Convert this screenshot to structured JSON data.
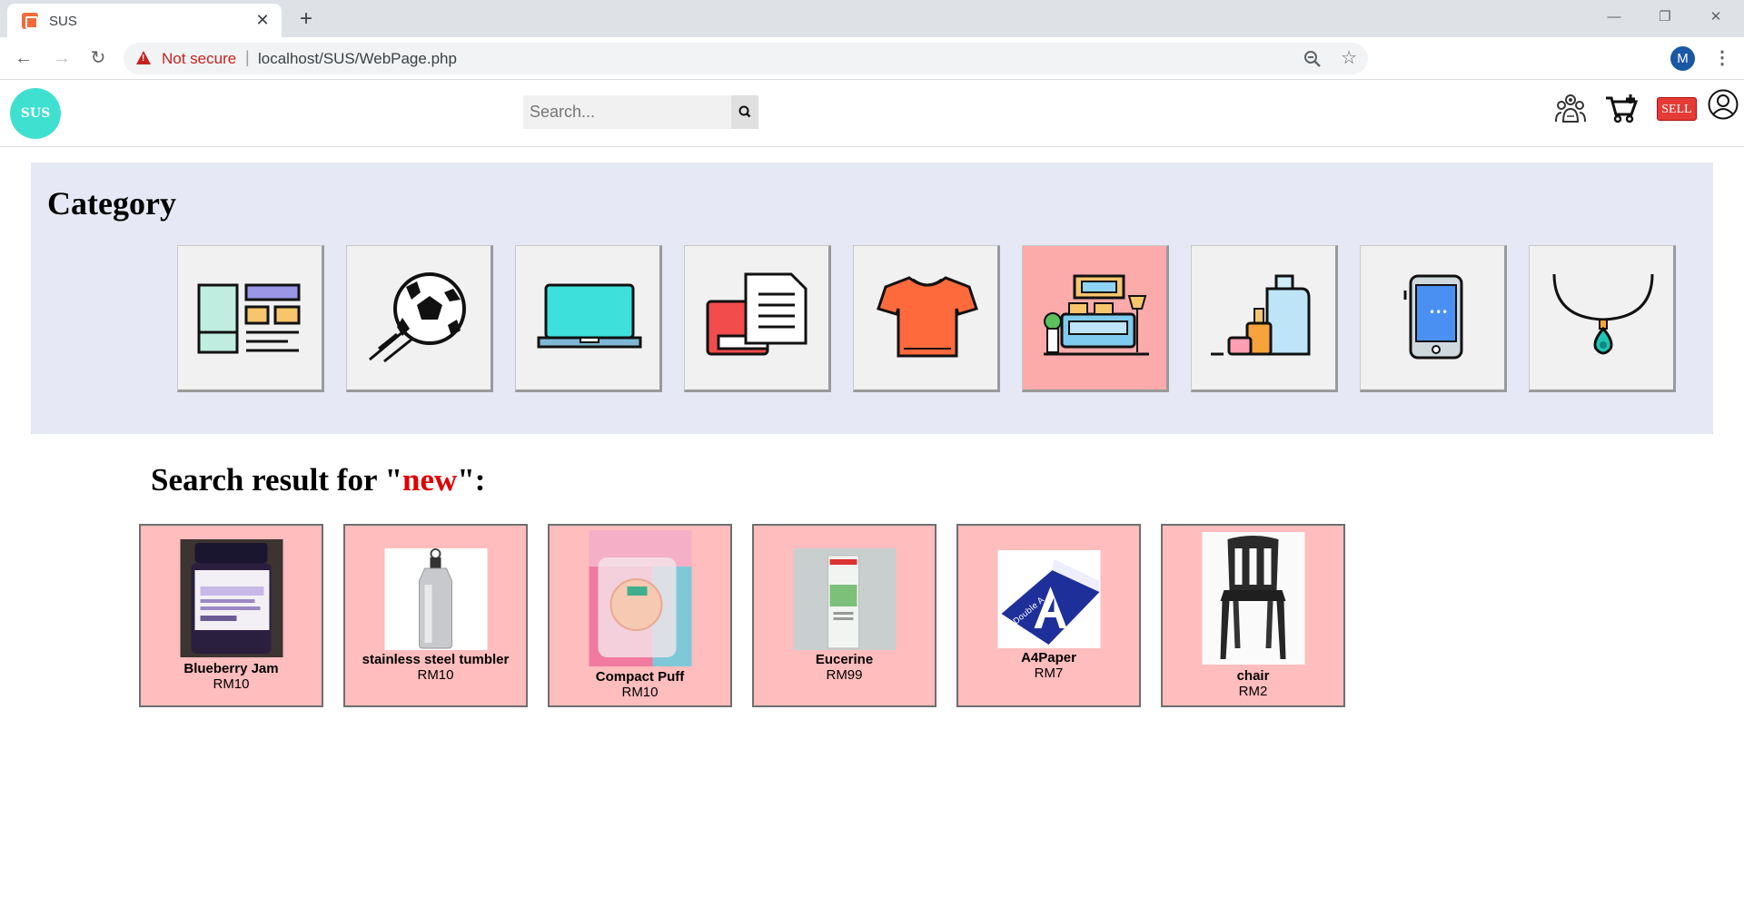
{
  "browser": {
    "tab_title": "SUS",
    "not_secure": "Not secure",
    "url": "localhost/SUS/WebPage.php",
    "profile_initial": "M"
  },
  "site": {
    "logo_text": "SUS",
    "search_placeholder": "Search...",
    "sell_label": "SELL"
  },
  "category": {
    "title": "Category",
    "tiles": [
      {
        "icon": "catalog-icon"
      },
      {
        "icon": "soccer-ball-icon"
      },
      {
        "icon": "laptop-icon"
      },
      {
        "icon": "books-documents-icon"
      },
      {
        "icon": "tshirt-icon"
      },
      {
        "icon": "furniture-icon",
        "active": true
      },
      {
        "icon": "cosmetics-icon"
      },
      {
        "icon": "smartphone-icon"
      },
      {
        "icon": "necklace-icon"
      }
    ]
  },
  "results": {
    "prefix": "Search result for \"",
    "keyword": "new",
    "suffix": "\":",
    "items": [
      {
        "name": "Blueberry Jam",
        "price": "RM10"
      },
      {
        "name": "stainless steel tumbler",
        "price": "RM10"
      },
      {
        "name": "Compact Puff",
        "price": "RM10"
      },
      {
        "name": "Eucerine",
        "price": "RM99"
      },
      {
        "name": "A4Paper",
        "price": "RM7"
      },
      {
        "name": "chair",
        "price": "RM2"
      }
    ]
  },
  "colors": {
    "accent_logo": "#3fe0d0",
    "category_bg": "#e6e8f5",
    "active_tile": "#fcaaaa",
    "card_bg": "#ffbdbd",
    "keyword": "#e00000"
  }
}
